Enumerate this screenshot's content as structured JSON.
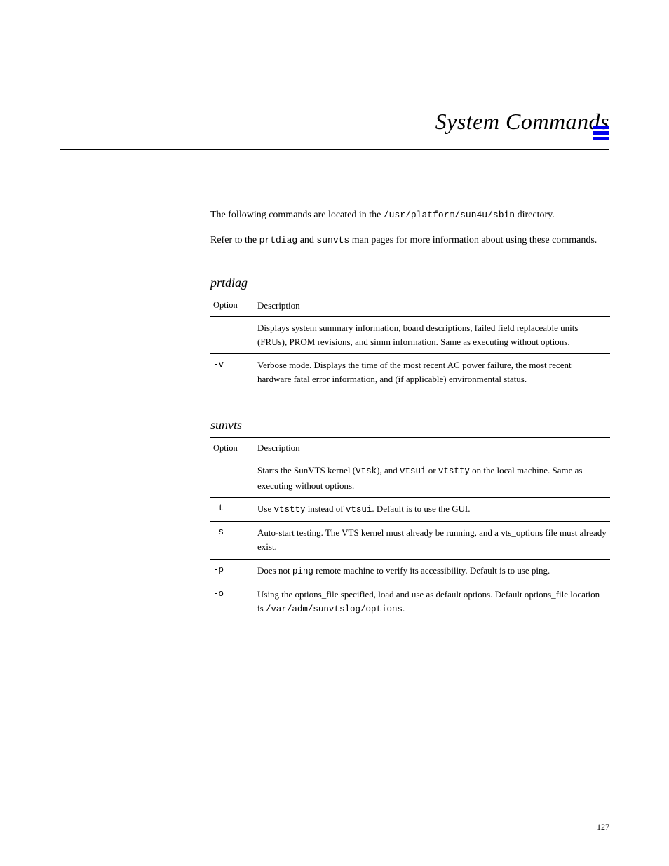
{
  "header": {
    "title": "System Commands"
  },
  "content": {
    "intro_1_pre": "The following commands are located in the ",
    "intro_1_code": "/usr/platform/sun4u/sbin",
    "intro_1_post": " directory.",
    "intro_2_pre": "Refer to the ",
    "intro_2_file": "prtdiag",
    "intro_2_mid": " and ",
    "intro_2_file2": "sunvts",
    "intro_2_post": " man pages for more information about using these commands."
  },
  "tables": [
    {
      "title": "prtdiag",
      "columns": [
        "Option",
        "Description"
      ],
      "rows": [
        {
          "flag": "",
          "desc": "Displays system summary information, board descriptions, failed field replaceable units (FRUs), PROM revisions, and simm information. Same as executing without options."
        },
        {
          "flag": "-v",
          "desc": "Verbose mode. Displays the time of the most recent AC power failure, the most recent hardware fatal error information, and (if applicable) environmental status."
        }
      ]
    },
    {
      "title": "sunvts",
      "columns": [
        "Option",
        "Description"
      ],
      "rows": [
        {
          "flag": "",
          "desc_pre": "Starts the SunVTS kernel (",
          "desc_code1": "vtsk",
          "desc_mid1": "), and ",
          "desc_code2": "vtsui",
          "desc_mid2": " or ",
          "desc_code3": "vtstty",
          "desc_post": " on the local machine. Same as executing without options."
        },
        {
          "flag": "-t",
          "desc_pre": "Use ",
          "desc_code1": "vtstty",
          "desc_mid1": " instead of ",
          "desc_code2": "vtsui",
          "desc_post": ". Default is to use the GUI."
        },
        {
          "flag": "-s",
          "desc": "Auto-start testing. The VTS kernel must already be running, and a vts_options file must already exist."
        },
        {
          "flag": "-p",
          "desc_pre": "Does not ",
          "desc_code1": "ping",
          "desc_post": " remote machine to verify its accessibility. Default is to use ping."
        },
        {
          "flag": "-o",
          "desc_pre": "Using the options_file specified, load and use as default options. Default options_file location is ",
          "desc_code1": "/var/adm/sunvtslog/options",
          "desc_post": ".",
          "noborder": true
        }
      ]
    }
  ],
  "footer": "127"
}
